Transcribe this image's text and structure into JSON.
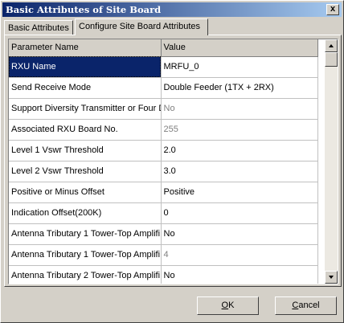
{
  "window": {
    "title": "Basic Attributes of Site Board",
    "close_glyph": "x"
  },
  "tabs": [
    {
      "label": "Basic Attributes",
      "active": false
    },
    {
      "label": "Configure Site Board Attributes",
      "active": true
    }
  ],
  "grid": {
    "columns": [
      "Parameter Name",
      "Value"
    ],
    "rows": [
      {
        "name": "RXU Name",
        "value": "MRFU_0",
        "selected": true,
        "dim": false
      },
      {
        "name": "Send Receive Mode",
        "value": "Double Feeder (1TX + 2RX)",
        "dim": false
      },
      {
        "name": "Support Diversity Transmitter or Four D",
        "value": "No",
        "dim": true
      },
      {
        "name": "Associated RXU Board No.",
        "value": "255",
        "dim": true
      },
      {
        "name": "Level 1 Vswr Threshold",
        "value": "2.0",
        "dim": false
      },
      {
        "name": "Level 2 Vswr Threshold",
        "value": "3.0",
        "dim": false
      },
      {
        "name": "Positive or Minus Offset",
        "value": "Positive",
        "dim": false
      },
      {
        "name": "Indication Offset(200K)",
        "value": "0",
        "dim": false
      },
      {
        "name": "Antenna Tributary 1 Tower-Top Amplifi",
        "value": "No",
        "dim": false
      },
      {
        "name": "Antenna Tributary 1 Tower-Top Amplifi",
        "value": "4",
        "dim": true
      },
      {
        "name": "Antenna Tributary 2 Tower-Top Amplifi",
        "value": "No",
        "dim": false
      },
      {
        "name": "",
        "value": "",
        "dim": false
      }
    ]
  },
  "scrollbar": {
    "up_icon": "triangle-up",
    "down_icon": "triangle-down"
  },
  "buttons": {
    "ok_first": "O",
    "ok_rest": "K",
    "cancel_first": "C",
    "cancel_rest": "ancel"
  }
}
